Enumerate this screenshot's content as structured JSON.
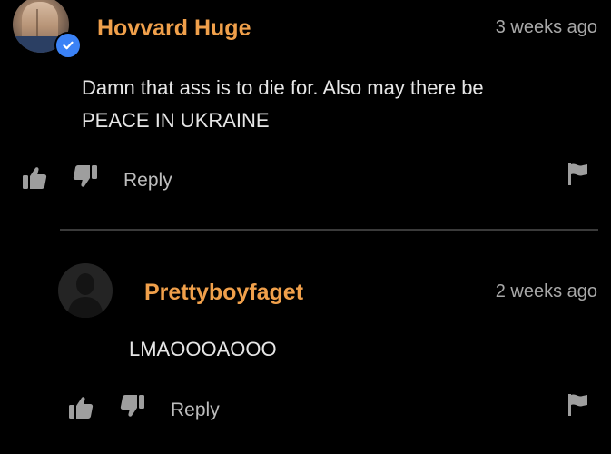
{
  "comments": [
    {
      "username": "Hovvard Huge",
      "timestamp": "3 weeks ago",
      "verified": true,
      "text_lines": [
        "Damn that ass is to die for. Also may there be",
        "PEACE IN UKRAINE"
      ],
      "reply_label": "Reply"
    },
    {
      "username": "Prettyboyfaget",
      "timestamp": "2 weeks ago",
      "verified": false,
      "text_lines": [
        "LMAOOOAOOO"
      ],
      "reply_label": "Reply"
    }
  ],
  "colors": {
    "background": "#000000",
    "username": "#f0a04b",
    "text": "#e6e6e6",
    "muted": "#a8a8a8",
    "verified_badge": "#3b82f6",
    "divider": "#3a3a3a"
  },
  "icons": {
    "like": "thumbs-up-icon",
    "dislike": "thumbs-down-icon",
    "report": "flag-icon",
    "verified": "check-icon",
    "default_avatar": "user-silhouette-icon"
  }
}
